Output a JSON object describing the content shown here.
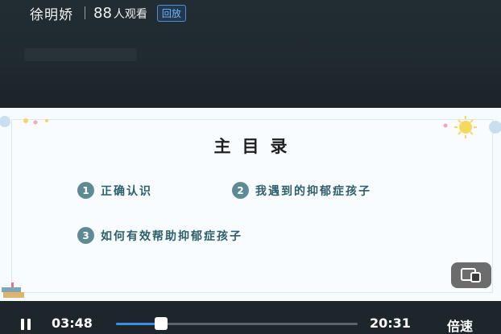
{
  "header": {
    "host_name": "徐明娇",
    "viewer_count": "88",
    "viewer_unit": "人观看",
    "replay_badge": "回放"
  },
  "slide": {
    "title": "主目录",
    "items": [
      {
        "num": "1",
        "text": "正确认识"
      },
      {
        "num": "2",
        "text": "我遇到的抑郁症孩子"
      },
      {
        "num": "3",
        "text": "如何有效帮助抑郁症孩子"
      }
    ]
  },
  "player": {
    "current_time": "03:48",
    "total_time": "20:31",
    "speed_label": "倍速",
    "progress": 0.186,
    "accent": "#3a8ee6"
  },
  "icons": {
    "pause": "pause-icon",
    "screen": "screen-mirror-icon"
  }
}
